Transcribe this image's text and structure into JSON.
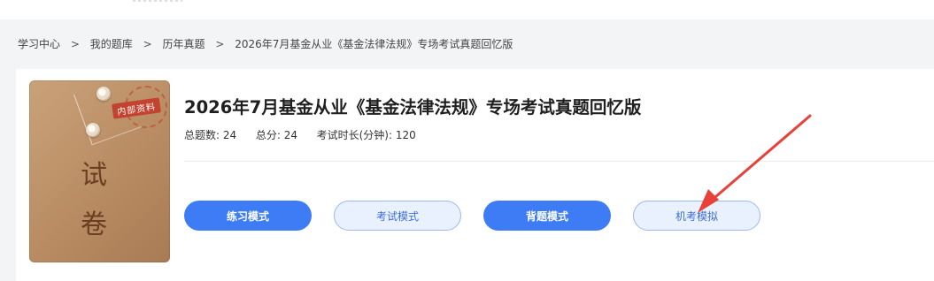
{
  "breadcrumb": {
    "items": [
      "学习中心",
      "我的题库",
      "历年真题"
    ],
    "separator": ">",
    "current": "2026年7月基金从业《基金法律法规》专场考试真题回忆版"
  },
  "exam": {
    "title": "2026年7月基金从业《基金法律法规》专场考试真题回忆版",
    "cover": {
      "stamp": "内部资料",
      "char1": "试",
      "char2": "卷"
    },
    "meta": {
      "total_questions_label": "总题数:",
      "total_questions": "24",
      "total_score_label": "总分:",
      "total_score": "24",
      "duration_label": "考试时长(分钟):",
      "duration": "120"
    }
  },
  "modes": {
    "practice": "练习模式",
    "exam": "考试模式",
    "recite": "背题模式",
    "computer_mock": "机考模拟"
  },
  "colors": {
    "primary": "#3d7cf5",
    "annotation_arrow": "#e8413a"
  }
}
